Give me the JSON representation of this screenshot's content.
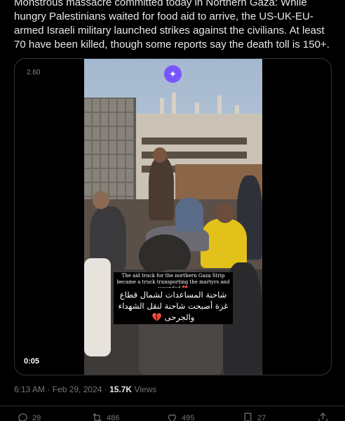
{
  "tweet": {
    "text": "Monstrous massacre committed today in Northern Gaza: While hungry Palestinians waited for food aid to arrive, the US-UK-EU-armed Israeli military launched strikes against the civilians. At least 70 have been killed, though some reports say the death toll is 150+."
  },
  "media": {
    "corner_tag": "2.60",
    "sparkle_icon": "sparkle-icon",
    "caption_en": "The aid truck for the northern Gaza Strip became a truck transporting the martyrs and wounded 💔",
    "caption_ar": "شاحنة المساعدات لشمال قطاع غزة أصبحت شاحنة لنقل الشهداء والجرحى 💔",
    "duration": "0:05"
  },
  "meta": {
    "time": "6:13 AM · Feb 29, 2024 · ",
    "views_count": "15.7K",
    "views_label": " Views"
  },
  "actions": {
    "replies": "29",
    "reposts": "486",
    "likes": "495",
    "bookmarks": "27"
  }
}
